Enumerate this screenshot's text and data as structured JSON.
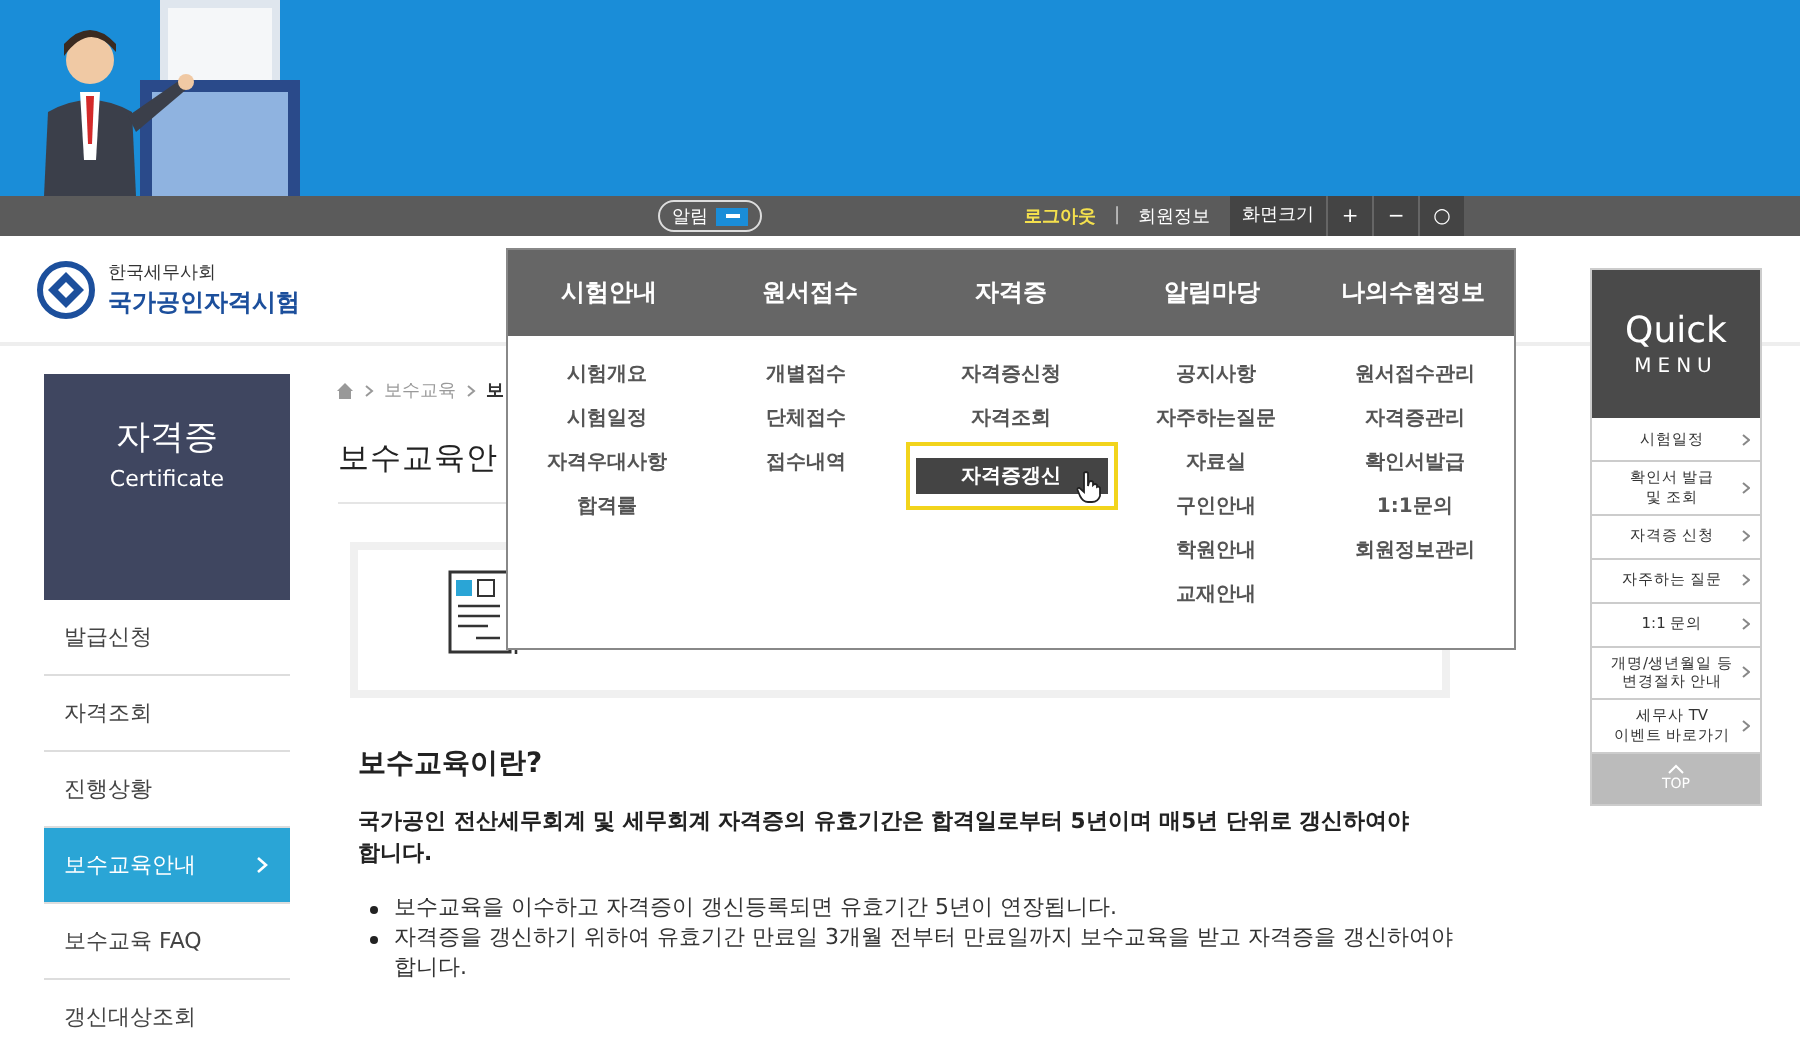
{
  "top_bar": {
    "alert": {
      "label": "알림",
      "on": true
    },
    "logout": "로그아웃",
    "separator": "|",
    "member_info": "회원정보",
    "font_size": {
      "label": "화면크기",
      "buttons": [
        "+",
        "−",
        "○"
      ]
    }
  },
  "logo": {
    "org": "한국세무사회",
    "title": "국가공인자격시험"
  },
  "mega_menu": {
    "columns": [
      {
        "title": "시험안내",
        "items": [
          {
            "label": "시험개요",
            "selected": false
          },
          {
            "label": "시험일정",
            "selected": false
          },
          {
            "label": "자격우대사항",
            "selected": false
          },
          {
            "label": "합격률",
            "selected": false
          }
        ]
      },
      {
        "title": "원서접수",
        "items": [
          {
            "label": "개별접수",
            "selected": false
          },
          {
            "label": "단체접수",
            "selected": false
          },
          {
            "label": "접수내역",
            "selected": false
          }
        ]
      },
      {
        "title": "자격증",
        "items": [
          {
            "label": "자격증신청",
            "selected": false
          },
          {
            "label": "자격조회",
            "selected": false
          },
          {
            "label": "자격증갱신",
            "selected": true
          }
        ]
      },
      {
        "title": "알림마당",
        "items": [
          {
            "label": "공지사항",
            "selected": false
          },
          {
            "label": "자주하는질문",
            "selected": false
          },
          {
            "label": "자료실",
            "selected": false
          },
          {
            "label": "구인안내",
            "selected": false
          },
          {
            "label": "학원안내",
            "selected": false
          },
          {
            "label": "교재안내",
            "selected": false
          }
        ]
      },
      {
        "title": "나의수험정보",
        "items": [
          {
            "label": "원서접수관리",
            "selected": false
          },
          {
            "label": "자격증관리",
            "selected": false
          },
          {
            "label": "확인서발급",
            "selected": false
          },
          {
            "label": "1:1문의",
            "selected": false
          },
          {
            "label": "회원정보관리",
            "selected": false
          }
        ]
      }
    ]
  },
  "sidebar": {
    "title": "자격증",
    "subtitle": "Certificate",
    "items": [
      {
        "label": "발급신청",
        "selected": false
      },
      {
        "label": "자격조회",
        "selected": false
      },
      {
        "label": "진행상황",
        "selected": false
      },
      {
        "label": "보수교육안내",
        "selected": true
      },
      {
        "label": "보수교육 FAQ",
        "selected": false
      },
      {
        "label": "갱신대상조회",
        "selected": false
      }
    ]
  },
  "breadcrumb": [
    "보수교육",
    "보"
  ],
  "page_title": "보수교육안",
  "section": {
    "heading": "보수교육이란?",
    "lead": "국가공인 전산세무회계 및 세무회계 자격증의 유효기간은 합격일로부터 5년이며 매5년 단위로 갱신하여야 합니다.",
    "bullets": [
      "보수교육을 이수하고 자격증이 갱신등록되면 유효기간 5년이 연장됩니다.",
      "자격증을 갱신하기 위하여 유효기간 만료일 3개월 전부터 만료일까지 보수교육을 받고 자격증을 갱신하여야 합니다."
    ]
  },
  "quick_menu": {
    "title": "Quick",
    "subtitle": "MENU",
    "items": [
      "시험일정",
      "확인서 발급\n및 조회",
      "자격증 신청",
      "자주하는 질문",
      "1:1 문의",
      "개명/생년월일 등\n변경절차 안내",
      "세무사 TV\n이벤트 바로가기"
    ],
    "top": "TOP"
  }
}
